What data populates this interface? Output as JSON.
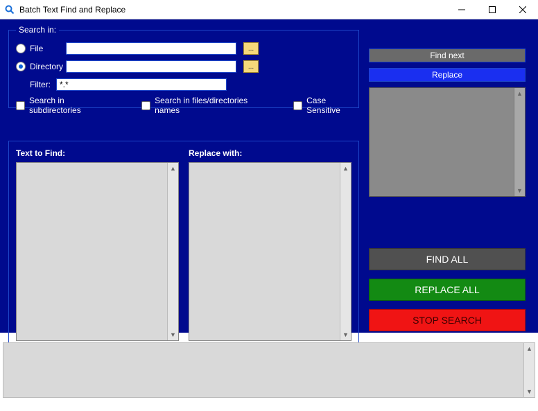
{
  "window": {
    "title": "Batch Text Find and Replace"
  },
  "searchin": {
    "legend": "Search in:",
    "file_label": "File",
    "directory_label": "Directory",
    "filter_label": "Filter:",
    "file_value": "",
    "directory_value": "",
    "filter_value": "*.*",
    "selected": "directory",
    "browse_label": "...",
    "subdirs_label": "Search in subdirectories",
    "names_label": "Search in files/directories names",
    "case_label": "Case Sensitive",
    "subdirs_checked": false,
    "names_checked": false,
    "case_checked": false
  },
  "panels": {
    "find_label": "Text to Find:",
    "replace_label": "Replace with:",
    "find_value": "",
    "replace_value": ""
  },
  "buttons": {
    "find_next": "Find next",
    "replace": "Replace",
    "find_all": "FIND ALL",
    "replace_all": "REPLACE ALL",
    "stop_search": "STOP SEARCH"
  },
  "colors": {
    "background": "#000a8e",
    "accent_blue": "#1a2ff0",
    "accent_green": "#138a13",
    "accent_red": "#f01414",
    "accent_gray": "#505050"
  }
}
